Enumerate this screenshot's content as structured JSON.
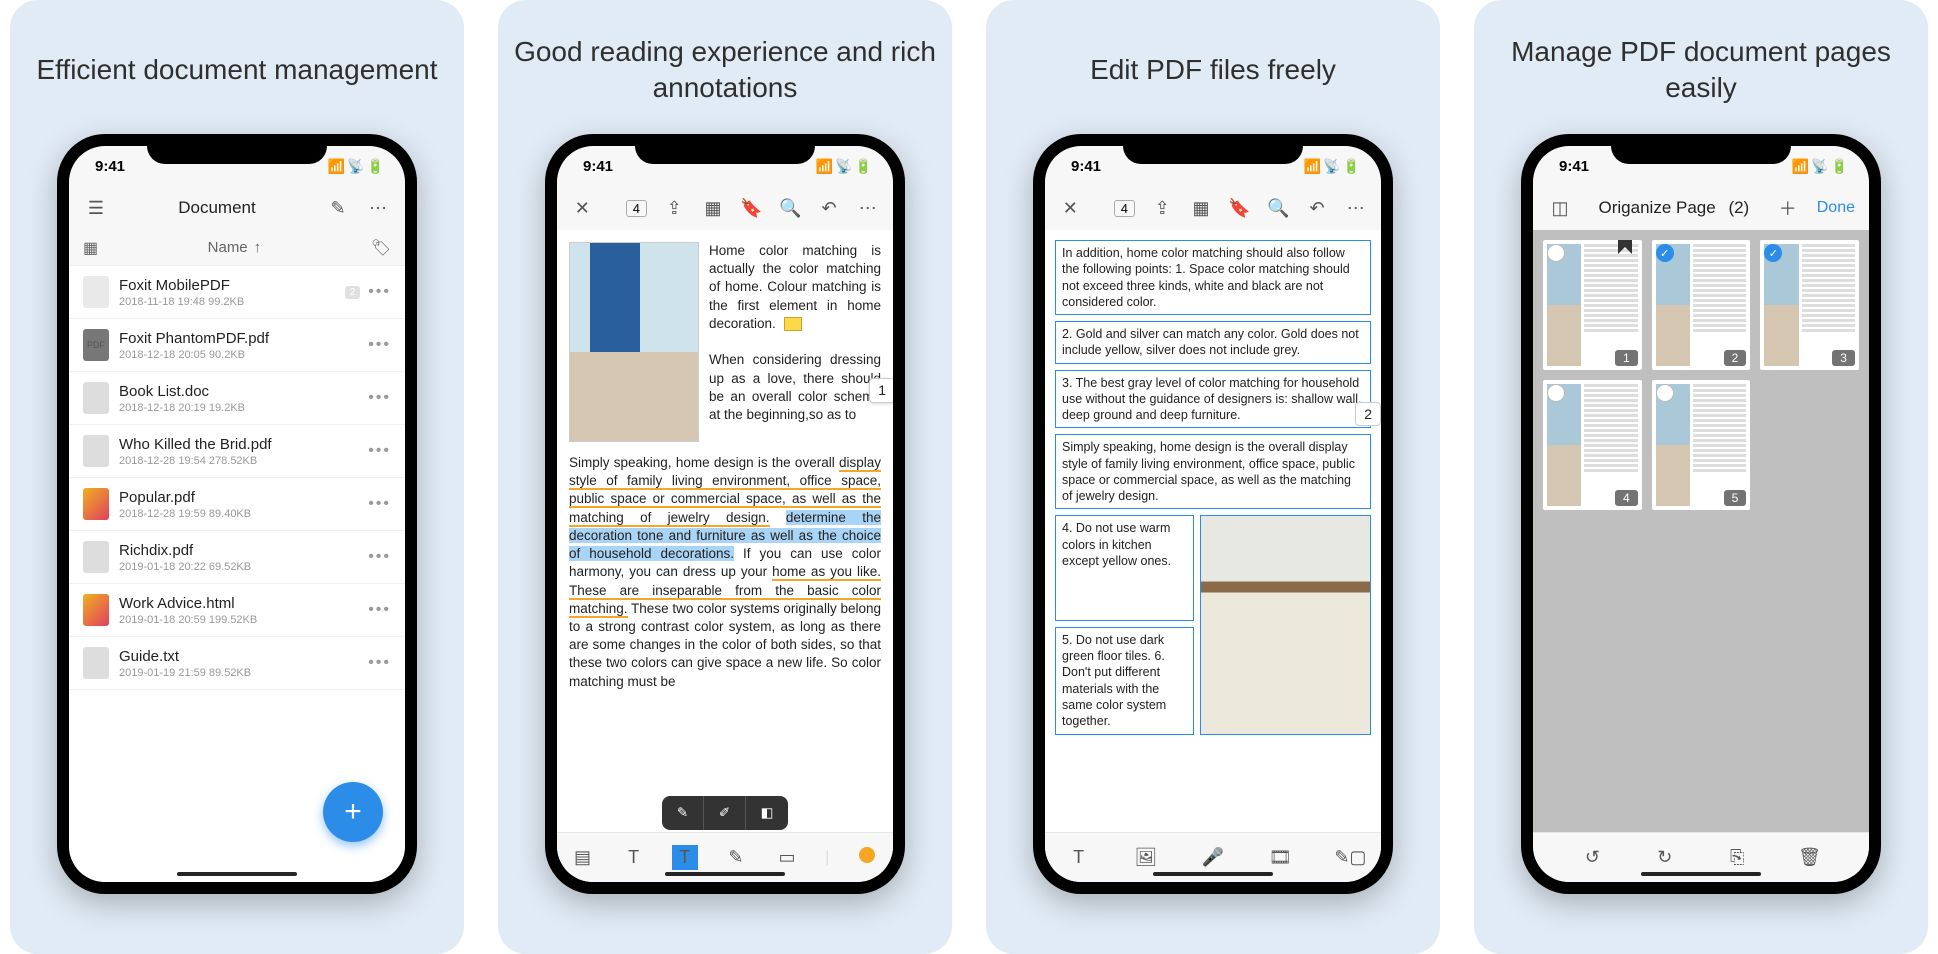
{
  "status_time": "9:41",
  "panels": [
    {
      "title": "Efficient document management"
    },
    {
      "title": "Good reading experience and rich annotations"
    },
    {
      "title": "Edit PDF files freely"
    },
    {
      "title": "Manage PDF document pages easily"
    }
  ],
  "doc_screen": {
    "header_title": "Document",
    "sort_label": "Name",
    "rows": [
      {
        "name": "Foxit MobilePDF",
        "date": "2018-11-18 19:48",
        "size": "99.2KB",
        "folder": true,
        "badge": "2"
      },
      {
        "name": "Foxit PhantomPDF.pdf",
        "date": "2018-12-18 20:05",
        "size": "90.2KB",
        "pdf": true
      },
      {
        "name": "Book List.doc",
        "date": "2018-12-18 20:19",
        "size": "19.2KB"
      },
      {
        "name": "Who Killed the Brid.pdf",
        "date": "2018-12-28 19:54",
        "size": "278.52KB"
      },
      {
        "name": "Popular.pdf",
        "date": "2018-12-28 19:59",
        "size": "89.40KB",
        "color": true
      },
      {
        "name": "Richdix.pdf",
        "date": "2019-01-18 20:22",
        "size": "69.52KB"
      },
      {
        "name": "Work Advice.html",
        "date": "2019-01-18 20:59",
        "size": "199.52KB",
        "color": true
      },
      {
        "name": "Guide.txt",
        "date": "2019-01-19 21:59",
        "size": "89.52KB"
      }
    ]
  },
  "reader": {
    "page_num_top": "4",
    "page_bubble": "1",
    "para_top": "Home color matching is actually the color matching of home. Colour matching is the first element in home decoration.",
    "para_mid": "When considering dressing up as a love, there should be an overall color scheme at the beginning,so as to",
    "para_plain1": "Simply speaking, home design is the overall ",
    "para_ul1": "display style of family living environment, office space, public space or commercial space, as well as the matching of jewelry design.",
    "para_hl": "determine the decoration tone and furniture as well as the choice of household decorations.",
    "para_plain2": " If you can use color harmony, you can dress up your ",
    "para_ul2": "home as you like. These are inseparable from the basic color matching.",
    "para_plain3": "  These two color systems originally belong to a strong contrast color system, as long as there are some changes in the color of both sides, so that these two colors can give space a new life. So color matching must be"
  },
  "edit": {
    "page_bubble": "2",
    "b1": "In addition, home color matching should also follow the following points:\n1. Space color matching should not exceed three kinds, white and black are not considered color.",
    "b2": "2. Gold and silver can match any color. Gold does not include yellow, silver does not include grey.",
    "b3": "3. The best gray level of color matching for household use without the guidance of designers is: shallow wall, deep ground and deep furniture.",
    "b4": "Simply speaking, home design is the overall display style of family living environment, office space, public space or commercial space, as well as the matching of jewelry design.",
    "b5": "4. Do not use warm colors in kitchen except yellow ones.",
    "b6": "5. Do not use dark green floor tiles.\n6. Don't put different materials with the same color system together."
  },
  "organize": {
    "title": "Origanize Page",
    "count": "(2)",
    "done": "Done",
    "pages": [
      {
        "n": "1",
        "checked": false,
        "bookmark": true
      },
      {
        "n": "2",
        "checked": true
      },
      {
        "n": "3",
        "checked": true
      },
      {
        "n": "4",
        "checked": false
      },
      {
        "n": "5",
        "checked": false
      }
    ]
  }
}
